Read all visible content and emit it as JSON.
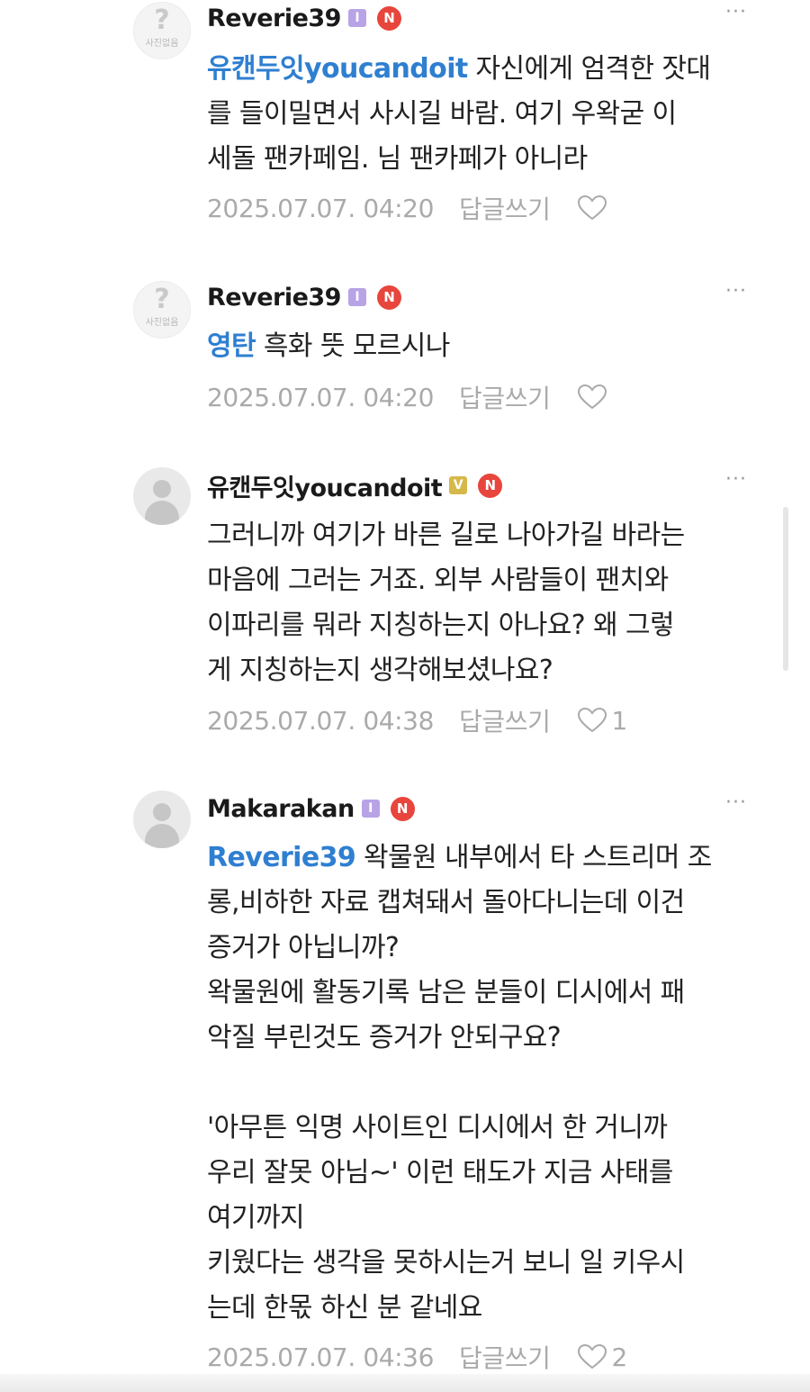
{
  "comments": [
    {
      "avatar_type": "no-photo",
      "avatar_icon": "question-mark",
      "avatar_caption": "사진없음",
      "nickname": "Reverie39",
      "level_badge": "I",
      "new_badge": "N",
      "more": "···",
      "mention": "유캔두잇youcandoit",
      "lines": [
        " 자신에게 엄격한 잣대",
        "를 들이밀면서 사시길 바람. 여기 우왁굳 이",
        "세돌 팬카페임. 님 팬카페가 아니라"
      ],
      "date": "2025.07.07. 04:20",
      "reply_label": "답글쓰기",
      "like_count": ""
    },
    {
      "avatar_type": "no-photo",
      "avatar_icon": "question-mark",
      "avatar_caption": "사진없음",
      "nickname": "Reverie39",
      "level_badge": "I",
      "new_badge": "N",
      "more": "···",
      "mention": "영탄",
      "lines": [
        " 흑화 뜻 모르시나"
      ],
      "date": "2025.07.07. 04:20",
      "reply_label": "답글쓰기",
      "like_count": ""
    },
    {
      "avatar_type": "default-person",
      "avatar_icon": "person",
      "nickname": "유캔두잇youcandoit",
      "level_badge": "V",
      "new_badge": "N",
      "more": "···",
      "mention": "",
      "lines": [
        "그러니까 여기가 바른 길로 나아가길 바라는",
        "마음에 그러는 거죠. 외부 사람들이 팬치와",
        "이파리를 뭐라 지칭하는지 아나요? 왜 그렇",
        "게 지칭하는지 생각해보셨나요?"
      ],
      "date": "2025.07.07. 04:38",
      "reply_label": "답글쓰기",
      "like_count": "1"
    },
    {
      "avatar_type": "default-person",
      "avatar_icon": "person",
      "nickname": "Makarakan",
      "level_badge": "I",
      "new_badge": "N",
      "more": "···",
      "mention": "Reverie39",
      "lines": [
        " 왁물원 내부에서 타 스트리머 조",
        "롱,비하한 자료 캡쳐돼서 돌아다니는데 이건",
        "증거가 아닙니까?",
        "왁물원에 활동기록 남은 분들이 디시에서 패",
        "악질 부린것도 증거가 안되구요?",
        "",
        "'아무튼 익명 사이트인 디시에서 한 거니까",
        "우리 잘못 아님~' 이런 태도가 지금 사태를",
        "여기까지",
        "키웠다는 생각을 못하시는거 보니 일 키우시",
        "는데 한몫 하신 분 같네요"
      ],
      "date": "2025.07.07. 04:36",
      "reply_label": "답글쓰기",
      "like_count": "2"
    }
  ],
  "colors": {
    "mention": "#2f7fd1",
    "new_badge": "#e8453c",
    "level_purple": "#b8a3e6",
    "level_gold": "#d6b84a",
    "meta": "#aaaaaa"
  }
}
